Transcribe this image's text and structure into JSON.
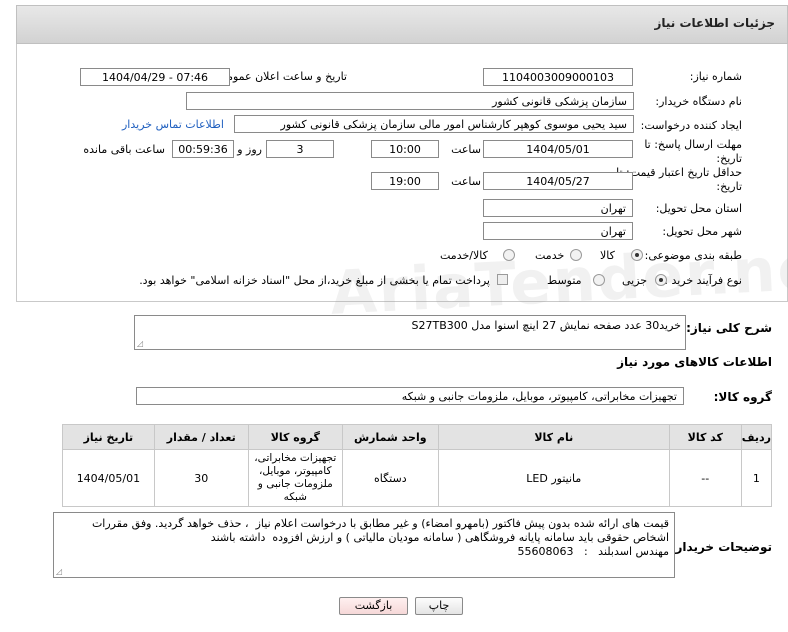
{
  "header": {
    "title": "جزئیات اطلاعات نیاز"
  },
  "form": {
    "need_number_label": "شماره نیاز:",
    "need_number": "1104003009000103",
    "announce_label": "تاریخ و ساعت اعلان عمومی:",
    "announce_value": "1404/04/29 - 07:46",
    "buyer_org_label": "نام دستگاه خریدار:",
    "buyer_org": "سازمان پزشکی قانونی کشور",
    "creator_label": "ایجاد کننده درخواست:",
    "creator": "سید یحیی موسوی کوهپر کارشناس امور مالی سازمان پزشکی قانونی کشور",
    "contact_link": "اطلاعات تماس خریدار",
    "reply_deadline_label": "مهلت ارسال پاسخ: تا تاریخ:",
    "reply_date": "1404/05/01",
    "time_label": "ساعت",
    "reply_time": "10:00",
    "days_value": "3",
    "days_label": "روز و",
    "remaining_value": "00:59:36",
    "remaining_label": "ساعت باقی مانده",
    "price_valid_label": "حداقل تاریخ اعتبار قیمت: تا تاریخ:",
    "price_valid_date": "1404/05/27",
    "price_valid_time": "19:00",
    "province_label": "استان محل تحویل:",
    "province": "تهران",
    "city_label": "شهر محل تحویل:",
    "city": "تهران",
    "category_label": "طبقه بندی موضوعی:",
    "category_options": [
      "کالا",
      "خدمت",
      "کالا/خدمت"
    ],
    "category_selected": "کالا",
    "process_label": "نوع فرآیند خرید :",
    "process_options": [
      "جزیی",
      "متوسط"
    ],
    "process_selected": "جزیی",
    "payment_note": "پرداخت تمام یا بخشی از مبلغ خرید،از محل \"اسناد خزانه اسلامی\" خواهد بود."
  },
  "watermark": "AriaTender.neT",
  "description": {
    "label": "شرح کلی نیاز:",
    "text": "خرید30 عدد صفحه نمایش 27 اینچ اسنوا مدل  S27TB300"
  },
  "goods_section_title": "اطلاعات کالاهای مورد نیاز",
  "goods_group": {
    "label": "گروه کالا:",
    "value": "تجهیزات مخابراتی، کامپیوتر، موبایل، ملزومات جانبی و شبکه"
  },
  "table": {
    "headers": [
      "ردیف",
      "کد کالا",
      "نام کالا",
      "واحد شمارش",
      "گروه کالا",
      "تعداد / مقدار",
      "تاریخ نیاز"
    ],
    "rows": [
      {
        "row": "1",
        "code": "--",
        "name": "مانیتور LED",
        "unit": "دستگاه",
        "group": "تجهیزات مخابراتی، کامپیوتر، موبایل، ملزومات جانبی و شبکه",
        "qty": "30",
        "date": "1404/05/01"
      }
    ]
  },
  "buyer_notes": {
    "label": "توضیحات خریدار:",
    "text": "قیمت های ارائه شده بدون پیش فاکتور (بامهرو امضاء) و غیر مطابق با درخواست اعلام نیاز  ، حذف خواهد گردید. وفق مقررات اشخاص حقوقی باید سامانه پایانه فروشگاهی ( سامانه مودیان مالیاتی ) و ارزش افزوده  داشته باشند\nمهندس اسدبلند   :   55608063"
  },
  "buttons": {
    "print": "چاپ",
    "back": "بازگشت"
  }
}
